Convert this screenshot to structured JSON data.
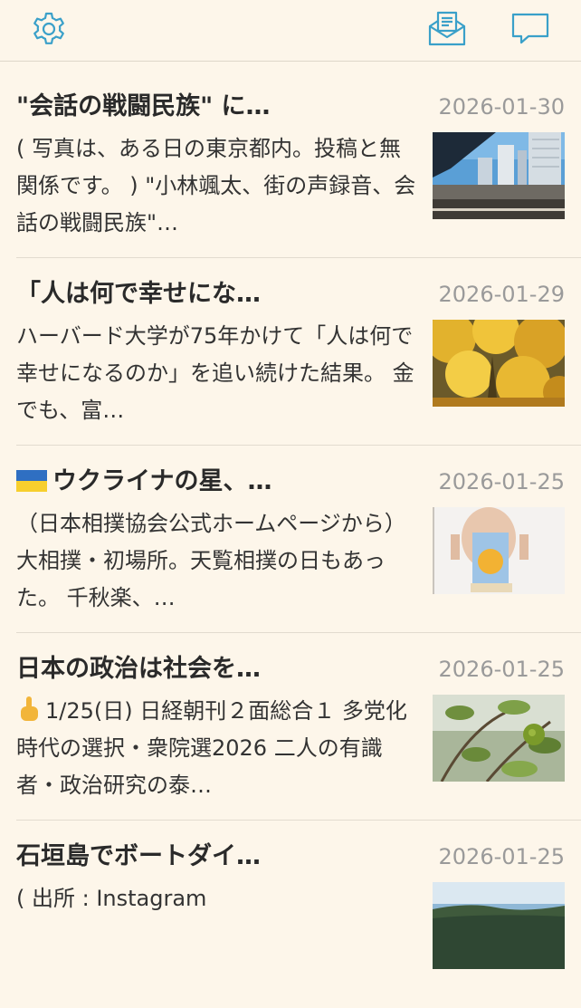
{
  "header": {
    "settings_icon": "gear-icon",
    "compose_icon": "mail-icon",
    "comments_icon": "chat-bubble-icon",
    "accent_color": "#3aa0c9"
  },
  "entries": [
    {
      "title": "\"会話の戦闘民族\" に…",
      "date": "2026-01-30",
      "excerpt": "( 写真は、ある日の東京都内。投稿と無関係です。 ) \"小林颯太、街の声録音、会話の戦闘民族\"…",
      "thumbnail": "city-towers-photo"
    },
    {
      "title": "「人は何で幸せにな…",
      "date": "2026-01-29",
      "excerpt": "ハーバード大学が75年かけて「人は何で幸せになるのか」を追い続けた結果。 金でも、富…",
      "thumbnail": "yellow-ginkgo-photo"
    },
    {
      "title": "ウクライナの星、…",
      "title_icon": "ukraine-flag-icon",
      "date": "2026-01-25",
      "excerpt": "（日本相撲協会公式ホームページから） 大相撲・初場所。天覧相撲の日もあった。 千秋楽、…",
      "thumbnail": "sumo-wrestler-photo"
    },
    {
      "title": "日本の政治は社会を…",
      "date": "2026-01-25",
      "excerpt": "1/25(日) 日経朝刊２面総合１ 多党化時代の選択・衆院選2026 二人の有識者・政治研究の泰…",
      "excerpt_icon": "pointing-finger-icon",
      "thumbnail": "citrus-tree-photo"
    },
    {
      "title": "石垣島でボートダイ…",
      "date": "2026-01-25",
      "excerpt": "( 出所 : Instagram",
      "thumbnail": "ocean-landscape-photo"
    }
  ]
}
